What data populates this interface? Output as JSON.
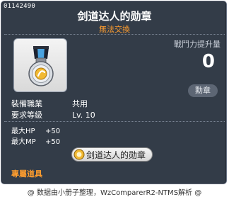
{
  "tooltip": {
    "item_id": "01142490",
    "item_name": "剑道达人的勋章",
    "item_sub": "無法交換",
    "stat_title": "戰鬥力提升量",
    "stat_value": "0",
    "category_tag": "勳章",
    "info": [
      {
        "label": "裝備職業",
        "value": "共用"
      },
      {
        "label": "要求等級",
        "value": "Lv. 10"
      }
    ],
    "stats": [
      {
        "label": "最大HP",
        "value": "+50"
      },
      {
        "label": "最大MP",
        "value": "+50"
      }
    ],
    "medal_button_label": "剑道达人的勋章",
    "exclusive_label": "專屬道具"
  },
  "footer": {
    "credit": "@ 数据由小册子整理，WzComparerR2-NTMS解析 @"
  },
  "icons": {
    "item_icon": "medal-icon",
    "button_icon": "medal-mini-icon"
  },
  "colors": {
    "panel_bg": "#333c48",
    "accent_orange": "#ff9d2e",
    "text_white": "#ffffff"
  }
}
